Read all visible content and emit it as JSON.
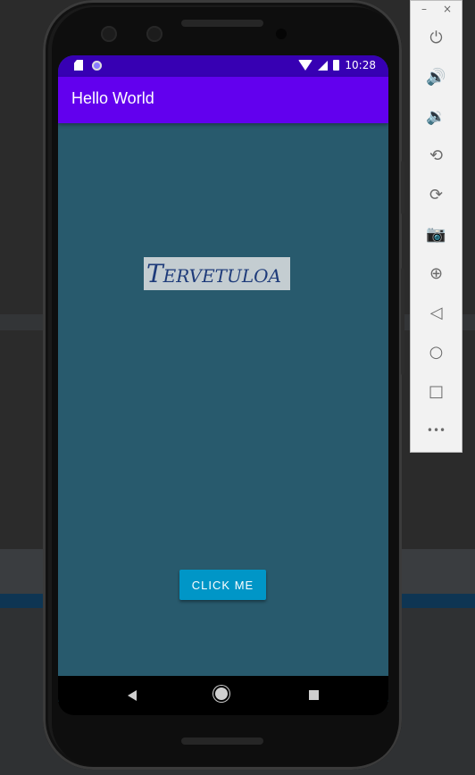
{
  "status_bar": {
    "time": "10:28"
  },
  "app": {
    "title": "Hello World",
    "center_text": "Tervetuloa",
    "button_label": "CLICK ME"
  },
  "toolbar": {
    "minimize": "–",
    "close": "×",
    "buttons": [
      {
        "name": "power-icon",
        "glyph": "⏻"
      },
      {
        "name": "volume-up-icon",
        "glyph": "🔊"
      },
      {
        "name": "volume-down-icon",
        "glyph": "🔉"
      },
      {
        "name": "rotate-left-icon",
        "glyph": "⟲"
      },
      {
        "name": "rotate-right-icon",
        "glyph": "⟳"
      },
      {
        "name": "camera-icon",
        "glyph": "📷"
      },
      {
        "name": "zoom-icon",
        "glyph": "⊕"
      },
      {
        "name": "back-icon",
        "glyph": "◁"
      },
      {
        "name": "home-icon",
        "glyph": "○"
      },
      {
        "name": "overview-icon",
        "glyph": "□"
      },
      {
        "name": "more-icon",
        "glyph": "•••"
      }
    ]
  },
  "colors": {
    "primary": "#6200ee",
    "primary_dark": "#3700b3",
    "background": "#285a6d",
    "button": "#0096c7"
  }
}
